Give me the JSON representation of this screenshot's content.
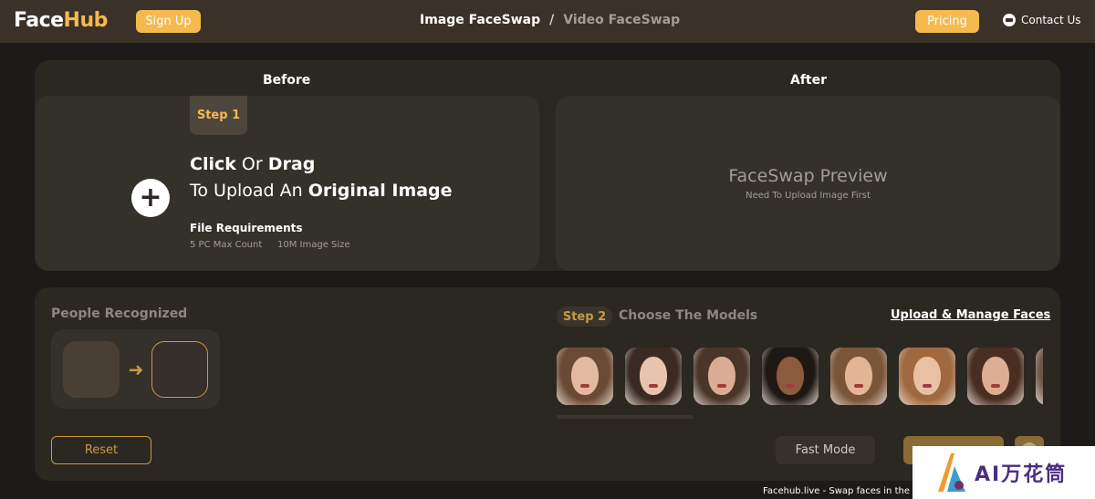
{
  "header": {
    "logo_face": "Face",
    "logo_hub": "Hub",
    "signup_label": "Sign Up",
    "nav_active": "Image FaceSwap",
    "nav_sep": "/",
    "nav_inactive": "Video FaceSwap",
    "pricing_label": "Pricing",
    "contact_label": "Contact Us",
    "contact_icon": "chat-icon"
  },
  "before": {
    "title": "Before",
    "step_label": "Step 1",
    "click": "Click",
    "or": "Or",
    "drag": "Drag",
    "to_upload": "To Upload An",
    "original_image": "Original Image",
    "plus_icon": "plus-icon",
    "file_req_title": "File Requirements",
    "max_count": "5 PC Max Count",
    "image_size": "10M Image Size"
  },
  "after": {
    "title": "After",
    "preview_title": "FaceSwap Preview",
    "preview_sub": "Need To Upload Image First"
  },
  "people": {
    "title": "People Recognized",
    "arrow_icon": "arrow-right-icon"
  },
  "models": {
    "step_label": "Step 2",
    "title": "Choose The Models",
    "manage_link": "Upload & Manage Faces",
    "faces": [
      {
        "name": "model-1",
        "hair": "#6b4a35",
        "skin": "#e3b9a1"
      },
      {
        "name": "model-2",
        "hair": "#3b2a22",
        "skin": "#e8c3ae"
      },
      {
        "name": "model-3",
        "hair": "#4a3528",
        "skin": "#d8ad93"
      },
      {
        "name": "model-4",
        "hair": "#1e1814",
        "skin": "#8c5a3e"
      },
      {
        "name": "model-5",
        "hair": "#7a5538",
        "skin": "#e2b597"
      },
      {
        "name": "model-6",
        "hair": "#a0683e",
        "skin": "#e8c0a4"
      },
      {
        "name": "model-7",
        "hair": "#4a2e22",
        "skin": "#dcae94"
      },
      {
        "name": "model-8",
        "hair": "#6a5446",
        "skin": "#d7b39c"
      }
    ]
  },
  "actions": {
    "reset_label": "Reset",
    "fast_mode_label": "Fast Mode"
  },
  "broken_image_alt": "Facehub.live - Swap faces in the ima",
  "watermark": {
    "text": "AI万花筒"
  },
  "colors": {
    "accent": "#f6b94e",
    "header_bg": "#3a3128",
    "panel_bg": "#2b2822",
    "page_bg": "#1c1b19"
  }
}
